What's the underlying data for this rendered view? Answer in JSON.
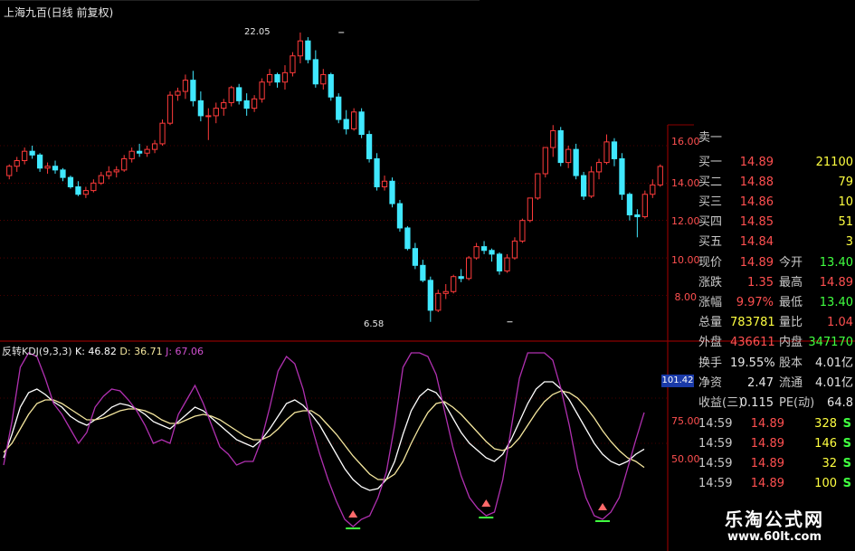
{
  "window": {
    "title": "上海九百(日线 前复权)"
  },
  "indicator": {
    "name": "反转KDJ(9,3,3)",
    "k_label": "K: 46.82",
    "d_label": "D: 36.71",
    "j_label": "J: 67.06",
    "cursor_value": "101.42"
  },
  "colors": {
    "up_candle": "#ff3b3b",
    "down_candle": "#40e8ff",
    "grid": "#8b0000",
    "k_line": "#ffffff",
    "d_line": "#f5e79e",
    "j_line": "#b030b0",
    "signal_up": "#ff6a6a",
    "signal_green": "#40ff40"
  },
  "chart_data": [
    {
      "type": "candlestick",
      "title": "上海九百(日线 前复权)",
      "y_ticks": [
        "16.00",
        "14.00",
        "12.00",
        "10.00",
        "8.00"
      ],
      "ylim": [
        5.6,
        23.4
      ],
      "annotations": [
        {
          "text": "22.05",
          "x_index": 43,
          "value": 22.05
        },
        {
          "text": "6.58",
          "x_index": 65,
          "value": 6.58
        }
      ],
      "ohlc": [
        [
          14.4,
          15.0,
          14.2,
          14.9
        ],
        [
          14.9,
          15.4,
          14.6,
          15.2
        ],
        [
          15.2,
          15.9,
          15.0,
          15.7
        ],
        [
          15.7,
          16.0,
          15.3,
          15.5
        ],
        [
          15.5,
          15.6,
          14.6,
          14.8
        ],
        [
          14.8,
          15.1,
          14.5,
          14.9
        ],
        [
          14.9,
          15.2,
          14.5,
          14.7
        ],
        [
          14.7,
          14.8,
          14.1,
          14.3
        ],
        [
          14.3,
          14.4,
          13.7,
          13.8
        ],
        [
          13.8,
          14.1,
          13.3,
          13.4
        ],
        [
          13.4,
          13.8,
          13.2,
          13.6
        ],
        [
          13.6,
          14.2,
          13.5,
          14.0
        ],
        [
          14.0,
          14.6,
          13.9,
          14.4
        ],
        [
          14.4,
          14.9,
          14.2,
          14.6
        ],
        [
          14.6,
          14.9,
          14.3,
          14.7
        ],
        [
          14.7,
          15.5,
          14.6,
          15.3
        ],
        [
          15.3,
          15.9,
          15.1,
          15.7
        ],
        [
          15.7,
          16.1,
          15.4,
          15.6
        ],
        [
          15.6,
          16.0,
          15.4,
          15.8
        ],
        [
          15.8,
          16.3,
          15.6,
          16.1
        ],
        [
          16.1,
          17.4,
          16.0,
          17.2
        ],
        [
          17.2,
          18.9,
          17.1,
          18.7
        ],
        [
          18.7,
          19.1,
          18.4,
          18.9
        ],
        [
          18.9,
          19.8,
          18.5,
          19.5
        ],
        [
          19.5,
          20.0,
          18.1,
          18.4
        ],
        [
          18.4,
          18.9,
          17.3,
          17.6
        ],
        [
          17.6,
          18.0,
          16.3,
          17.6
        ],
        [
          17.6,
          18.3,
          17.2,
          18.0
        ],
        [
          18.0,
          18.5,
          17.6,
          18.3
        ],
        [
          18.3,
          19.2,
          18.1,
          19.1
        ],
        [
          19.1,
          19.3,
          18.2,
          18.4
        ],
        [
          18.4,
          18.8,
          17.6,
          18.0
        ],
        [
          18.0,
          18.7,
          17.8,
          18.5
        ],
        [
          18.5,
          19.6,
          18.3,
          19.4
        ],
        [
          19.4,
          20.1,
          19.2,
          19.8
        ],
        [
          19.8,
          19.9,
          19.1,
          19.4
        ],
        [
          19.4,
          20.3,
          19.0,
          19.9
        ],
        [
          19.9,
          21.0,
          19.7,
          20.8
        ],
        [
          20.8,
          22.05,
          20.4,
          21.6
        ],
        [
          21.6,
          21.8,
          20.4,
          20.6
        ],
        [
          20.6,
          21.1,
          19.1,
          19.3
        ],
        [
          19.3,
          20.1,
          19.0,
          19.8
        ],
        [
          19.8,
          19.9,
          18.4,
          18.6
        ],
        [
          18.6,
          18.8,
          17.2,
          17.4
        ],
        [
          17.4,
          17.9,
          16.6,
          16.9
        ],
        [
          16.9,
          18.0,
          16.8,
          17.8
        ],
        [
          17.8,
          18.0,
          16.4,
          16.6
        ],
        [
          16.6,
          16.8,
          15.1,
          15.3
        ],
        [
          15.3,
          15.6,
          13.6,
          13.8
        ],
        [
          13.8,
          14.4,
          13.6,
          14.1
        ],
        [
          14.1,
          14.3,
          12.7,
          12.9
        ],
        [
          12.9,
          13.1,
          11.4,
          11.6
        ],
        [
          11.6,
          11.7,
          10.4,
          10.5
        ],
        [
          10.5,
          10.8,
          9.4,
          9.6
        ],
        [
          9.6,
          9.9,
          8.7,
          8.8
        ],
        [
          8.8,
          9.0,
          6.58,
          7.2
        ],
        [
          7.2,
          8.3,
          7.1,
          8.1
        ],
        [
          8.1,
          8.6,
          7.8,
          8.2
        ],
        [
          8.2,
          9.1,
          8.1,
          9.0
        ],
        [
          9.0,
          9.4,
          8.7,
          8.9
        ],
        [
          8.9,
          10.1,
          8.8,
          10.0
        ],
        [
          10.0,
          10.8,
          9.9,
          10.6
        ],
        [
          10.6,
          10.9,
          10.2,
          10.4
        ],
        [
          10.4,
          10.5,
          9.8,
          10.2
        ],
        [
          10.2,
          10.3,
          9.1,
          9.3
        ],
        [
          9.3,
          10.2,
          9.2,
          10.0
        ],
        [
          10.0,
          11.1,
          9.9,
          10.9
        ],
        [
          10.9,
          12.1,
          10.8,
          12.0
        ],
        [
          12.0,
          13.2,
          11.9,
          13.2
        ],
        [
          13.2,
          14.5,
          13.1,
          14.5
        ],
        [
          14.5,
          15.9,
          14.3,
          15.9
        ],
        [
          15.9,
          17.1,
          15.4,
          16.8
        ],
        [
          16.8,
          17.0,
          14.9,
          15.1
        ],
        [
          15.1,
          16.0,
          14.8,
          15.8
        ],
        [
          15.8,
          16.1,
          14.2,
          14.4
        ],
        [
          14.4,
          14.6,
          13.1,
          13.3
        ],
        [
          13.3,
          14.9,
          13.2,
          14.6
        ],
        [
          14.6,
          15.3,
          14.2,
          15.1
        ],
        [
          15.1,
          16.6,
          15.0,
          16.2
        ],
        [
          16.2,
          16.4,
          14.9,
          15.3
        ],
        [
          15.3,
          15.6,
          13.1,
          13.4
        ],
        [
          13.4,
          13.5,
          12.0,
          12.3
        ],
        [
          12.3,
          12.6,
          11.1,
          12.2
        ],
        [
          12.2,
          13.6,
          12.1,
          13.4
        ],
        [
          13.4,
          14.2,
          13.2,
          13.9
        ],
        [
          13.9,
          15.0,
          13.8,
          14.89
        ]
      ]
    },
    {
      "type": "line",
      "title": "反转KDJ(9,3,3)",
      "y_ticks": [
        "75.00",
        "50.00"
      ],
      "ylim": [
        -5,
        105
      ],
      "series": [
        {
          "name": "K",
          "values": [
            42,
            55,
            70,
            78,
            80,
            77,
            73,
            70,
            65,
            62,
            60,
            63,
            66,
            70,
            72,
            71,
            69,
            66,
            62,
            60,
            58,
            62,
            66,
            70,
            68,
            64,
            60,
            56,
            52,
            50,
            48,
            52,
            58,
            65,
            72,
            74,
            71,
            66,
            60,
            52,
            44,
            36,
            30,
            26,
            24,
            25,
            30,
            40,
            55,
            68,
            76,
            80,
            78,
            72,
            64,
            56,
            50,
            46,
            42,
            40,
            44,
            52,
            62,
            72,
            80,
            84,
            84,
            80,
            74,
            66,
            58,
            50,
            44,
            40,
            38,
            40,
            44,
            46.82
          ]
        },
        {
          "name": "D",
          "values": [
            45,
            50,
            58,
            66,
            72,
            74,
            74,
            72,
            69,
            66,
            63,
            63,
            64,
            66,
            68,
            69,
            69,
            68,
            66,
            63,
            61,
            61,
            63,
            65,
            66,
            65,
            63,
            60,
            57,
            54,
            52,
            52,
            54,
            58,
            63,
            67,
            68,
            68,
            65,
            60,
            55,
            49,
            43,
            38,
            33,
            30,
            30,
            33,
            40,
            50,
            59,
            67,
            72,
            73,
            70,
            66,
            61,
            56,
            51,
            47,
            46,
            48,
            53,
            60,
            67,
            73,
            77,
            79,
            78,
            75,
            70,
            64,
            57,
            51,
            46,
            42,
            40,
            36.71
          ]
        },
        {
          "name": "J",
          "values": [
            38,
            62,
            92,
            100,
            98,
            86,
            72,
            66,
            58,
            50,
            56,
            70,
            76,
            80,
            79,
            74,
            68,
            60,
            50,
            52,
            50,
            66,
            74,
            82,
            72,
            60,
            48,
            44,
            38,
            40,
            40,
            52,
            70,
            90,
            98,
            94,
            80,
            60,
            44,
            30,
            18,
            8,
            4,
            8,
            10,
            20,
            34,
            60,
            92,
            100,
            100,
            98,
            88,
            68,
            48,
            32,
            20,
            14,
            10,
            12,
            30,
            58,
            86,
            100,
            100,
            100,
            96,
            80,
            60,
            36,
            20,
            10,
            8,
            12,
            20,
            36,
            52,
            67.06
          ]
        }
      ]
    }
  ],
  "quote": {
    "sell_one": {
      "label": "卖一"
    },
    "buys": [
      {
        "label": "买一",
        "price": "14.89",
        "vol": "21100"
      },
      {
        "label": "买二",
        "price": "14.88",
        "vol": "79"
      },
      {
        "label": "买三",
        "price": "14.86",
        "vol": "10"
      },
      {
        "label": "买四",
        "price": "14.85",
        "vol": "51"
      },
      {
        "label": "买五",
        "price": "14.84",
        "vol": "3"
      }
    ],
    "stats": [
      {
        "l1": "现价",
        "v1": "14.89",
        "l2": "今开",
        "v2": "13.40",
        "v1c": "red",
        "v2c": "green"
      },
      {
        "l1": "涨跌",
        "v1": "1.35",
        "l2": "最高",
        "v2": "14.89",
        "v1c": "red",
        "v2c": "red"
      },
      {
        "l1": "涨幅",
        "v1": "9.97%",
        "l2": "最低",
        "v2": "13.40",
        "v1c": "red",
        "v2c": "green"
      },
      {
        "l1": "总量",
        "v1": "783781",
        "l2": "量比",
        "v2": "1.04",
        "v1c": "yellow",
        "v2c": "red"
      },
      {
        "l1": "外盘",
        "v1": "436611",
        "l2": "内盘",
        "v2": "347170",
        "v1c": "red",
        "v2c": "green"
      }
    ],
    "funds": [
      {
        "l1": "换手",
        "v1": "19.55%",
        "l2": "股本",
        "v2": "4.01亿"
      },
      {
        "l1": "净资",
        "v1": "2.47",
        "l2": "流通",
        "v2": "4.01亿"
      },
      {
        "l1": "收益(三)",
        "v1": "0.115",
        "l2": "PE(动)",
        "v2": "64.8"
      }
    ],
    "ticks": [
      {
        "time": "14:59",
        "price": "14.89",
        "vol": "328",
        "flag": "S"
      },
      {
        "time": "14:59",
        "price": "14.89",
        "vol": "146",
        "flag": "S"
      },
      {
        "time": "14:59",
        "price": "14.89",
        "vol": "32",
        "flag": "S"
      },
      {
        "time": "14:59",
        "price": "14.89",
        "vol": "100",
        "flag": "S"
      }
    ]
  },
  "watermark": {
    "title": "乐淘公式网",
    "url": "www.60lt.com"
  }
}
